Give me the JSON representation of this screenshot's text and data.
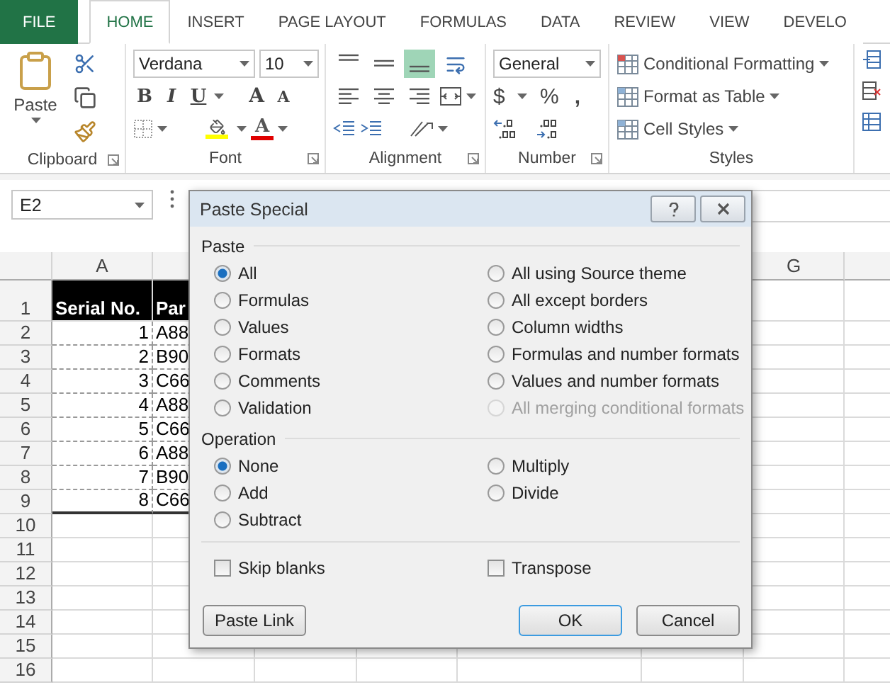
{
  "ribbon_tabs": [
    {
      "label": "FILE",
      "kind": "file",
      "selected": false
    },
    {
      "label": "HOME",
      "kind": "tab",
      "selected": true
    },
    {
      "label": "INSERT",
      "kind": "tab",
      "selected": false
    },
    {
      "label": "PAGE LAYOUT",
      "kind": "tab",
      "selected": false
    },
    {
      "label": "FORMULAS",
      "kind": "tab",
      "selected": false
    },
    {
      "label": "DATA",
      "kind": "tab",
      "selected": false
    },
    {
      "label": "REVIEW",
      "kind": "tab",
      "selected": false
    },
    {
      "label": "VIEW",
      "kind": "tab",
      "selected": false
    },
    {
      "label": "DEVELO",
      "kind": "tab",
      "selected": false
    }
  ],
  "ribbon": {
    "clipboard": {
      "label": "Clipboard",
      "paste": "Paste"
    },
    "font": {
      "label": "Font",
      "font_name": "Verdana",
      "font_size": "10",
      "bold": "B",
      "italic": "I",
      "underline": "U",
      "grow": "A",
      "shrink": "A",
      "font_color": "A"
    },
    "alignment": {
      "label": "Alignment",
      "vertical_align": [
        {
          "selected": false
        },
        {
          "selected": false
        },
        {
          "selected": true
        }
      ]
    },
    "number": {
      "label": "Number",
      "format": "General",
      "currency": "$",
      "percent": "%",
      "comma": ","
    },
    "styles": {
      "label": "Styles",
      "items": [
        "Conditional Formatting",
        "Format as Table",
        "Cell Styles"
      ]
    }
  },
  "name_box": "E2",
  "sheet": {
    "column_headers": [
      "A",
      "G"
    ],
    "row_numbers": [
      "1",
      "2",
      "3",
      "4",
      "5",
      "6",
      "7",
      "8",
      "9",
      "10",
      "11",
      "12",
      "13",
      "14",
      "15",
      "16"
    ],
    "header": {
      "serial": "Serial No.",
      "part": "Par"
    },
    "rows": [
      {
        "serial": "1",
        "part": "A88"
      },
      {
        "serial": "2",
        "part": "B90"
      },
      {
        "serial": "3",
        "part": "C66"
      },
      {
        "serial": "4",
        "part": "A88"
      },
      {
        "serial": "5",
        "part": "C66"
      },
      {
        "serial": "6",
        "part": "A88"
      },
      {
        "serial": "7",
        "part": "B90"
      },
      {
        "serial": "8",
        "part": "C66"
      }
    ]
  },
  "dialog": {
    "title": "Paste Special",
    "paste": {
      "label": "Paste",
      "options": [
        {
          "label": "All",
          "selected": true,
          "disabled": false
        },
        {
          "label": "Formulas",
          "selected": false,
          "disabled": false
        },
        {
          "label": "Values",
          "selected": false,
          "disabled": false
        },
        {
          "label": "Formats",
          "selected": false,
          "disabled": false
        },
        {
          "label": "Comments",
          "selected": false,
          "disabled": false
        },
        {
          "label": "Validation",
          "selected": false,
          "disabled": false
        },
        {
          "label": "All using Source theme",
          "selected": false,
          "disabled": false
        },
        {
          "label": "All except borders",
          "selected": false,
          "disabled": false
        },
        {
          "label": "Column widths",
          "selected": false,
          "disabled": false
        },
        {
          "label": "Formulas and number formats",
          "selected": false,
          "disabled": false
        },
        {
          "label": "Values and number formats",
          "selected": false,
          "disabled": false
        },
        {
          "label": "All merging conditional formats",
          "selected": false,
          "disabled": true
        }
      ]
    },
    "operation": {
      "label": "Operation",
      "options": [
        {
          "label": "None",
          "selected": true
        },
        {
          "label": "Add",
          "selected": false
        },
        {
          "label": "Subtract",
          "selected": false
        },
        {
          "label": "Multiply",
          "selected": false
        },
        {
          "label": "Divide",
          "selected": false
        }
      ]
    },
    "checkboxes": [
      {
        "label": "Skip blanks",
        "checked": false
      },
      {
        "label": "Transpose",
        "checked": false
      }
    ],
    "buttons": [
      {
        "label": "Paste Link",
        "default": false
      },
      {
        "label": "OK",
        "default": true
      },
      {
        "label": "Cancel",
        "default": false
      }
    ]
  }
}
